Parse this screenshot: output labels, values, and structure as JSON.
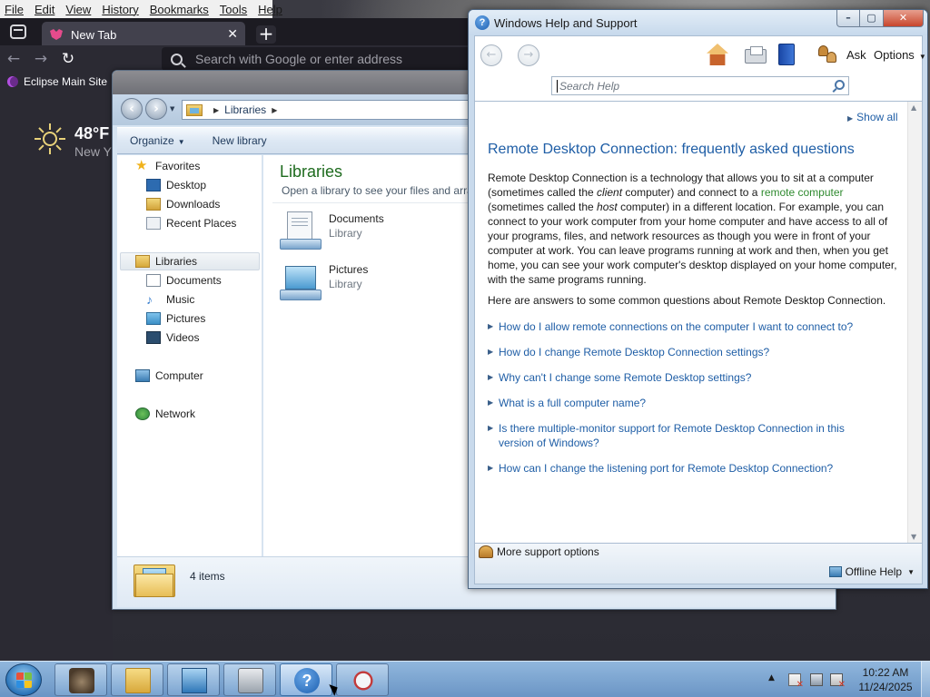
{
  "firefox": {
    "menu": [
      "File",
      "Edit",
      "View",
      "History",
      "Bookmarks",
      "Tools",
      "Help"
    ],
    "tab_title": "New Tab",
    "url_placeholder": "Search with Google or enter address",
    "bookmark": "Eclipse Main Site",
    "weather": {
      "temp": "48°F",
      "city": "New Y"
    }
  },
  "explorer": {
    "breadcrumb": "Libraries",
    "toolbar": {
      "organize": "Organize",
      "new_library": "New library"
    },
    "nav": {
      "favorites": "Favorites",
      "favorites_items": [
        "Desktop",
        "Downloads",
        "Recent Places"
      ],
      "libraries": "Libraries",
      "libraries_items": [
        "Documents",
        "Music",
        "Pictures",
        "Videos"
      ],
      "computer": "Computer",
      "network": "Network"
    },
    "main": {
      "title": "Libraries",
      "subtitle": "Open a library to see your files and arra",
      "entries": [
        {
          "name": "Documents",
          "type": "Library"
        },
        {
          "name": "Pictures",
          "type": "Library"
        }
      ]
    },
    "details": {
      "count": "4 items"
    }
  },
  "help": {
    "window_title": "Windows Help and Support",
    "toolbar": {
      "ask": "Ask",
      "options": "Options"
    },
    "search_placeholder": "Search Help",
    "show_all": "Show all",
    "heading": "Remote Desktop Connection: frequently asked questions",
    "para": {
      "p1": "Remote Desktop Connection is a technology that allows you to sit at a computer (sometimes called the ",
      "client": "client",
      "p2": " computer) and connect to a ",
      "remote_link": "remote computer",
      "p3": " (sometimes called the ",
      "host": "host",
      "p4": " computer) in a different location. For example, you can connect to your work computer from your home computer and have access to all of your programs, files, and network resources as though you were in front of your computer at work. You can leave programs running at work and then, when you get home, you can see your work computer's desktop displayed on your home computer, with the same programs running."
    },
    "intro": "Here are answers to some common questions about Remote Desktop Connection.",
    "faqs": [
      "How do I allow remote connections on the computer I want to connect to?",
      "How do I change Remote Desktop Connection settings?",
      "Why can't I change some Remote Desktop settings?",
      "What is a full computer name?",
      "Is there multiple-monitor support for Remote Desktop Connection in this version of Windows?",
      "How can I change the listening port for Remote Desktop Connection?"
    ],
    "footer": {
      "more_support": "More support options",
      "offline_help": "Offline Help"
    }
  },
  "taskbar": {
    "clock_time": "10:22 AM",
    "clock_date": "11/24/2025"
  },
  "colors": {
    "link": "#1f5ea6",
    "green_link": "#2f8a2f",
    "library_title": "#1e6b1e",
    "firefox_dark": "#2b2a33"
  }
}
